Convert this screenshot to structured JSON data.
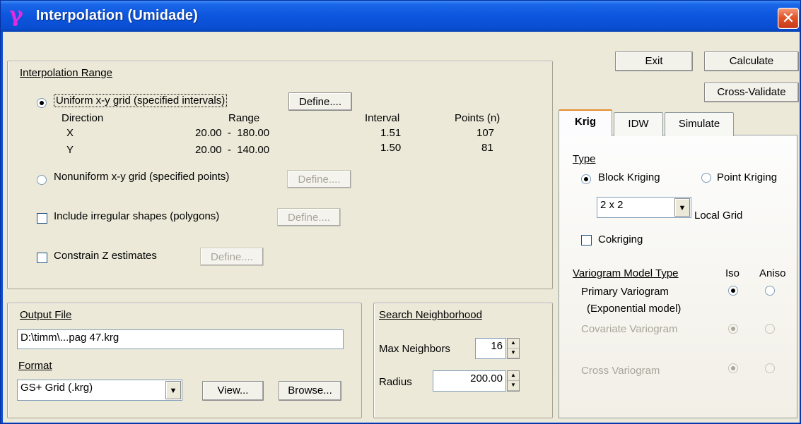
{
  "window": {
    "title": "Interpolation (Umidade)",
    "app_icon": "γ",
    "close_icon": "✕"
  },
  "buttons": {
    "exit": "Exit",
    "calculate": "Calculate",
    "cross_validate": "Cross-Validate"
  },
  "interp_range": {
    "title": "Interpolation Range",
    "uniform_label": "Uniform x-y grid  (specified intervals)",
    "uniform_checked": true,
    "define_label": "Define....",
    "headers": {
      "direction": "Direction",
      "range": "Range",
      "interval": "Interval",
      "points": "Points (n)"
    },
    "rows": [
      {
        "direction": "X",
        "range": "20.00  -  180.00",
        "interval": "1.51",
        "points": "107"
      },
      {
        "direction": "Y",
        "range": "20.00  -  140.00",
        "interval": "1.50",
        "points": "81"
      }
    ],
    "nonuniform_label": "Nonuniform x-y grid (specified points)",
    "irregular_label": "Include irregular shapes (polygons)",
    "constrain_label": "Constrain Z estimates"
  },
  "output": {
    "title": "Output File",
    "path": "D:\\timm\\...pag 47.krg",
    "format_label": "Format",
    "format_value": "GS+ Grid (.krg)",
    "view_label": "View...",
    "browse_label": "Browse..."
  },
  "search": {
    "title": "Search  Neighborhood",
    "max_neighbors_label": "Max Neighbors",
    "max_neighbors_value": "16",
    "radius_label": "Radius",
    "radius_value": "200.00"
  },
  "tabs": [
    {
      "label": "Krig",
      "active": true
    },
    {
      "label": "IDW",
      "active": false
    },
    {
      "label": "Simulate",
      "active": false
    }
  ],
  "krig": {
    "type_label": "Type",
    "block_label": "Block Kriging",
    "block_checked": true,
    "point_label": "Point Kriging",
    "local_grid_value": "2 x 2",
    "local_grid_label": "Local Grid",
    "cokriging_label": "Cokriging",
    "variogram_title": "Variogram Model Type",
    "iso_label": "Iso",
    "aniso_label": "Aniso",
    "primary_label": "Primary Variogram",
    "primary_sub": "(Exponential model)",
    "covariate_label": "Covariate Variogram",
    "cross_label": "Cross Variogram"
  },
  "colors": {
    "title_bar": "#0a4fd8",
    "dialog_face": "#ece9d8",
    "close_button": "#e2552a",
    "radio_dot": "#21a121",
    "active_tab_accent": "#e68b2c"
  }
}
